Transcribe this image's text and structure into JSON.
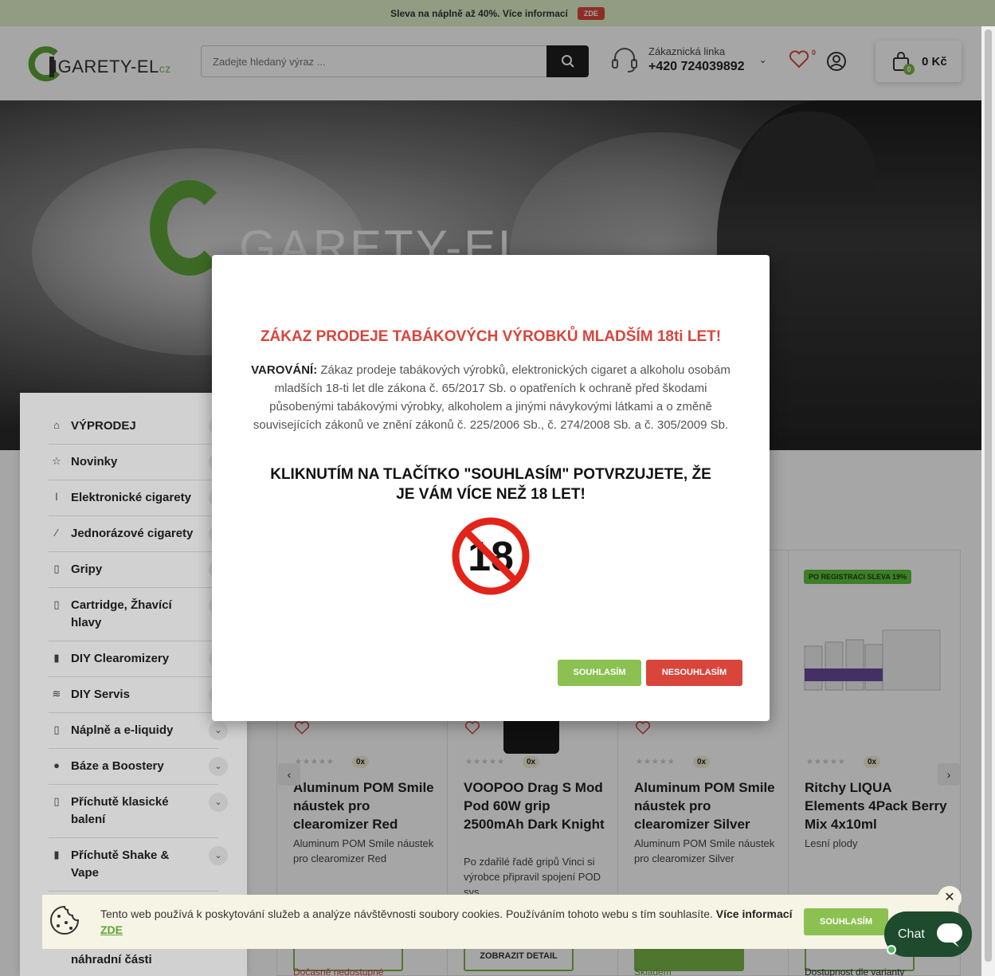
{
  "promo": {
    "text": "Sleva na náplně až 40%. Více informací",
    "badge": "ZDE"
  },
  "header": {
    "logo_text": "IGARETY-EL",
    "logo_suffix": "cz",
    "search_placeholder": "Zadejte hledaný výraz ...",
    "hotline_label": "Zákaznická linka",
    "hotline_number": "+420 724039892",
    "wishlist_count": "0",
    "cart_count": "0",
    "cart_total": "0 Kč"
  },
  "hero": {
    "logo_text": "GARETY-EL"
  },
  "sidebar": {
    "items": [
      {
        "label": "VÝPRODEJ",
        "icon": "tag-icon"
      },
      {
        "label": "Novinky",
        "icon": "star-icon"
      },
      {
        "label": "Elektronické cigarety",
        "icon": "ecig-icon"
      },
      {
        "label": "Jednorázové cigarety",
        "icon": "disposable-icon"
      },
      {
        "label": "Gripy",
        "icon": "grip-icon"
      },
      {
        "label": "Cartridge, Žhavící hlavy",
        "icon": "cartridge-icon"
      },
      {
        "label": "DIY Clearomizery",
        "icon": "clearomizer-icon"
      },
      {
        "label": "DIY Servis",
        "icon": "coil-icon"
      },
      {
        "label": "Náplně a e-liquidy",
        "icon": "liquid-icon"
      },
      {
        "label": "Báze a Boostery",
        "icon": "drop-icon"
      },
      {
        "label": "Příchutě klasické balení",
        "icon": "flavor-icon"
      },
      {
        "label": "Příchutě Shake & Vape",
        "icon": "shake-icon"
      }
    ],
    "partial_label": "náhradní části"
  },
  "products": [
    {
      "title": "Aluminum POM Smile náustek pro clearomizer Red",
      "desc": "Aluminum POM Smile náustek pro clearomizer Red",
      "rating_count": "0x",
      "stock": "Dočasně nedostupné",
      "stock_color": "#d9453b"
    },
    {
      "title": "VOOPOO Drag S Mod Pod 60W grip 2500mAh Dark Knight",
      "desc": "Po zdařilé řadě gripů Vinci si výrobce připravil spojení POD sys",
      "rating_count": "0x",
      "detail": "ZOBRAZIT DETAIL"
    },
    {
      "title": "Aluminum POM Smile náustek pro clearomizer Silver",
      "desc": "Aluminum POM Smile náustek pro clearomizer Silver",
      "rating_count": "0x",
      "stock": "Skladem",
      "stock_color": "#5da438"
    },
    {
      "title": "Ritchy LIQUA Elements 4Pack Berry Mix 4x10ml",
      "desc": "Lesní plody",
      "rating_count": "0x",
      "badge": "PO REGISTRACI SLEVA 19%",
      "stock": "Dostupnost dle varianty",
      "stock_color": "#333333"
    }
  ],
  "modal": {
    "title": "ZÁKAZ PRODEJE TABÁKOVÝCH VÝROBKŮ MLADŠÍM 18ti LET!",
    "warning_label": "VAROVÁNÍ:",
    "warning_text": "Zákaz prodeje tabákových výrobků, elektronických cigaret a alkoholu osobám mladších 18-ti let dle zákona č. 65/2017 Sb. o opatřeních k ochraně před škodami působenými tabákovými výrobky, alkoholem a jinými návykovými látkami a o změně souvisejících zákonů ve znění zákonů č. 225/2006 Sb., č. 274/2008 Sb. a č. 305/2009 Sb.",
    "confirm_text": "KLIKNUTÍM NA TLAČÍTKO \"SOUHLASÍM\" POTVRZUJETE, ŽE JE VÁM VÍCE NEŽ 18 LET!",
    "sign_number": "18",
    "agree": "SOUHLASÍM",
    "disagree": "NESOUHLASÍM"
  },
  "cookie": {
    "text": "Tento web používá k poskytování služeb a analýze návštěvnosti soubory cookies. Používáním tohoto webu s tím souhlasíte.",
    "more": "Více informací",
    "zde": "ZDE",
    "ok": "SOUHLASÍM",
    "close": "✕"
  },
  "chat": {
    "label": "Chat"
  },
  "colors": {
    "brand_green": "#7ab648",
    "danger_red": "#d9453b",
    "dark": "#1e1e1e"
  }
}
